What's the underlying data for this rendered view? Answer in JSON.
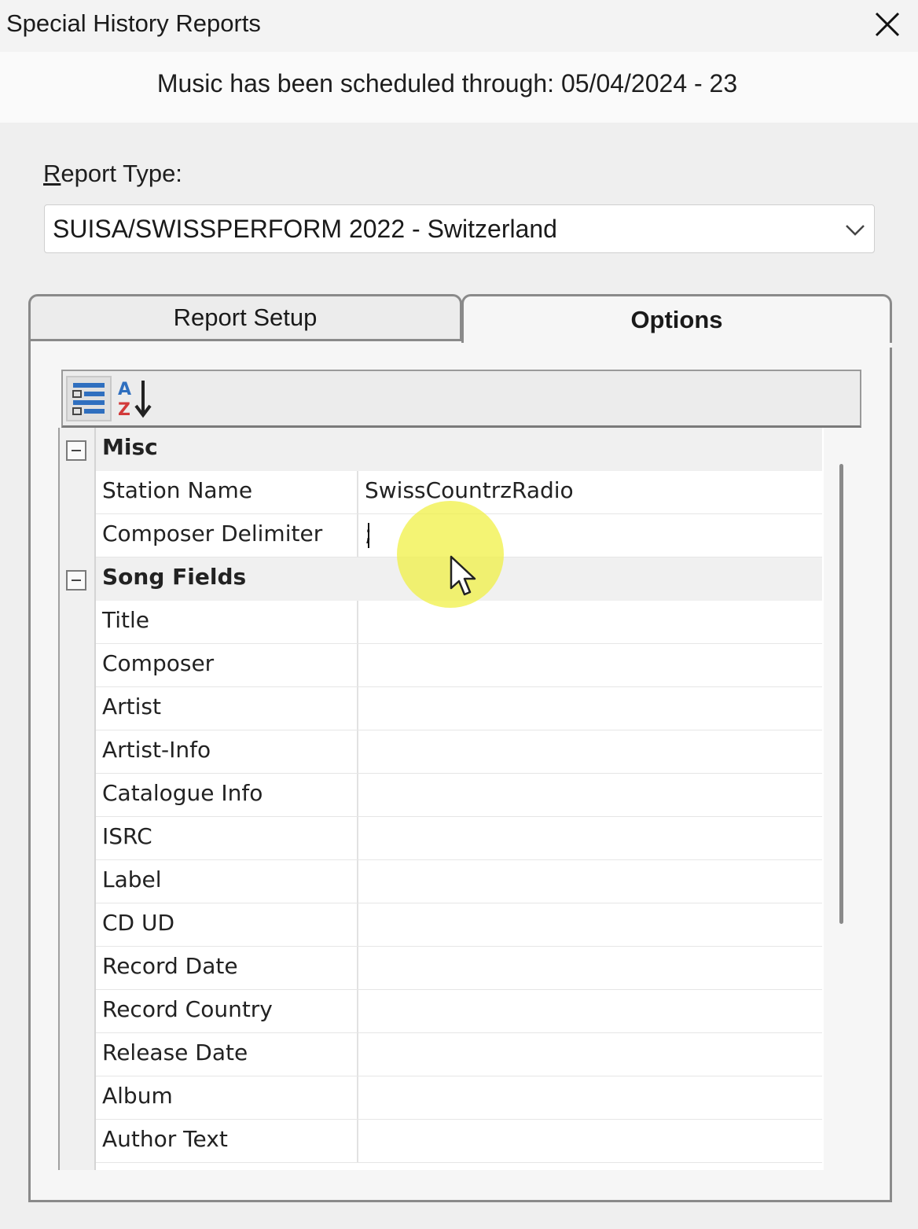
{
  "window": {
    "title": "Special History Reports",
    "close_icon": "close-icon"
  },
  "banner": {
    "text": "Music has been scheduled through: 05/04/2024 - 23"
  },
  "report_type": {
    "label_first": "R",
    "label_rest": "eport Type:",
    "selected": "SUISA/SWISSPERFORM 2022 - Switzerland"
  },
  "tabs": [
    {
      "label": "Report Setup",
      "active": false
    },
    {
      "label": "Options",
      "active": true
    }
  ],
  "toolbar": {
    "categorized_icon": "categorized-view-icon",
    "alphabetical_icon": "sort-az-icon"
  },
  "property_grid": {
    "categories": [
      {
        "name": "Misc",
        "expanded": true,
        "properties": [
          {
            "name": "Station Name",
            "value": "SwissCountrzRadio"
          },
          {
            "name": "Composer Delimiter",
            "value": ";"
          }
        ]
      },
      {
        "name": "Song Fields",
        "expanded": true,
        "properties": [
          {
            "name": "Title",
            "value": ""
          },
          {
            "name": "Composer",
            "value": ""
          },
          {
            "name": "Artist",
            "value": ""
          },
          {
            "name": "Artist-Info",
            "value": ""
          },
          {
            "name": "Catalogue Info",
            "value": ""
          },
          {
            "name": "ISRC",
            "value": ""
          },
          {
            "name": "Label",
            "value": ""
          },
          {
            "name": "CD UD",
            "value": ""
          },
          {
            "name": "Record Date",
            "value": ""
          },
          {
            "name": "Record Country",
            "value": ""
          },
          {
            "name": "Release Date",
            "value": ""
          },
          {
            "name": "Album",
            "value": ""
          },
          {
            "name": "Author Text",
            "value": ""
          }
        ]
      }
    ]
  },
  "colors": {
    "click_highlight": "#f0f046",
    "background": "#efefef"
  }
}
